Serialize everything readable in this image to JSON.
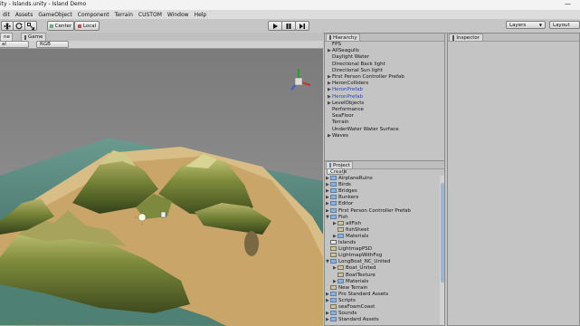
{
  "window": {
    "title": "ity - Islands.unity - Island Demo",
    "minimize_glyph": "—"
  },
  "menu": [
    "dit",
    "Assets",
    "GameObject",
    "Component",
    "Terrain",
    "CUSTOM",
    "Window",
    "Help"
  ],
  "toolbar": {
    "pivot_label": "Center",
    "space_label": "Local",
    "play_icon": "play-icon",
    "pause_icon": "pause-icon",
    "step_icon": "step-icon",
    "layers_label": "Layers",
    "layout_label": "Layout"
  },
  "scene": {
    "tab_scene": "ne",
    "tab_game": "Game",
    "draw_mode": "al",
    "render_mode": "RGB"
  },
  "hierarchy": {
    "tab": "Hierarchy",
    "items": [
      {
        "label": "FPS",
        "arrow": "",
        "blue": false
      },
      {
        "label": "AllSeagulls",
        "arrow": "▶",
        "blue": false
      },
      {
        "label": "Daylight Water",
        "arrow": "",
        "blue": false
      },
      {
        "label": "Directional Back light",
        "arrow": "",
        "blue": false
      },
      {
        "label": "Directional Sun light",
        "arrow": "",
        "blue": false
      },
      {
        "label": "First Person Controller Prefab",
        "arrow": "▶",
        "blue": false
      },
      {
        "label": "HeronColliders",
        "arrow": "▶",
        "blue": false
      },
      {
        "label": "HeronPrefab",
        "arrow": "▶",
        "blue": true
      },
      {
        "label": "HeronPrefab",
        "arrow": "▶",
        "blue": true
      },
      {
        "label": "LevelObjects",
        "arrow": "▶",
        "blue": false
      },
      {
        "label": "Performance",
        "arrow": "",
        "blue": false
      },
      {
        "label": "SeaFloor",
        "arrow": "",
        "blue": false
      },
      {
        "label": "Terrain",
        "arrow": "",
        "blue": false
      },
      {
        "label": "UnderWater Water Surface",
        "arrow": "",
        "blue": false
      },
      {
        "label": "Waves",
        "arrow": "▶",
        "blue": false
      }
    ]
  },
  "inspector": {
    "tab": "Inspector"
  },
  "project": {
    "tab": "Project",
    "create_label": "Create",
    "items": [
      {
        "label": "AirplaneRuins",
        "arrow": "▶",
        "indent": 0,
        "type": "folder"
      },
      {
        "label": "Birds",
        "arrow": "▶",
        "indent": 0,
        "type": "folder"
      },
      {
        "label": "Bridges",
        "arrow": "▶",
        "indent": 0,
        "type": "folder"
      },
      {
        "label": "Bunkers",
        "arrow": "▶",
        "indent": 0,
        "type": "folder"
      },
      {
        "label": "Editor",
        "arrow": "▶",
        "indent": 0,
        "type": "folder"
      },
      {
        "label": "First Person Controller Prefab",
        "arrow": "▶",
        "indent": 0,
        "type": "folder"
      },
      {
        "label": "Fish",
        "arrow": "▼",
        "indent": 0,
        "type": "folder"
      },
      {
        "label": "allFish",
        "arrow": "▶",
        "indent": 1,
        "type": "asset"
      },
      {
        "label": "fishSheet",
        "arrow": "",
        "indent": 1,
        "type": "asset"
      },
      {
        "label": "Materials",
        "arrow": "▶",
        "indent": 1,
        "type": "folder"
      },
      {
        "label": "Islands",
        "arrow": "",
        "indent": 0,
        "type": "scene"
      },
      {
        "label": "LightmapPSD",
        "arrow": "",
        "indent": 0,
        "type": "asset"
      },
      {
        "label": "LightmapWithFog",
        "arrow": "",
        "indent": 0,
        "type": "asset"
      },
      {
        "label": "LongBoat_NC_United",
        "arrow": "▼",
        "indent": 0,
        "type": "folder"
      },
      {
        "label": "Boat_United",
        "arrow": "▶",
        "indent": 1,
        "type": "asset"
      },
      {
        "label": "BoatTexture",
        "arrow": "",
        "indent": 1,
        "type": "asset"
      },
      {
        "label": "Materials",
        "arrow": "▶",
        "indent": 1,
        "type": "folder"
      },
      {
        "label": "New Terrain",
        "arrow": "",
        "indent": 0,
        "type": "asset"
      },
      {
        "label": "Pro Standard Assets",
        "arrow": "▶",
        "indent": 0,
        "type": "folder"
      },
      {
        "label": "Scripts",
        "arrow": "▶",
        "indent": 0,
        "type": "folder"
      },
      {
        "label": "seaFoamCoast",
        "arrow": "",
        "indent": 0,
        "type": "asset"
      },
      {
        "label": "Sounds",
        "arrow": "▶",
        "indent": 0,
        "type": "folder"
      },
      {
        "label": "Standard Assets",
        "arrow": "▶",
        "indent": 0,
        "type": "folder"
      }
    ]
  },
  "colors": {
    "accent": "#2444c4",
    "panel": "#c4c4c4",
    "water": "#4f7f73",
    "sand": "#e3c48a"
  }
}
